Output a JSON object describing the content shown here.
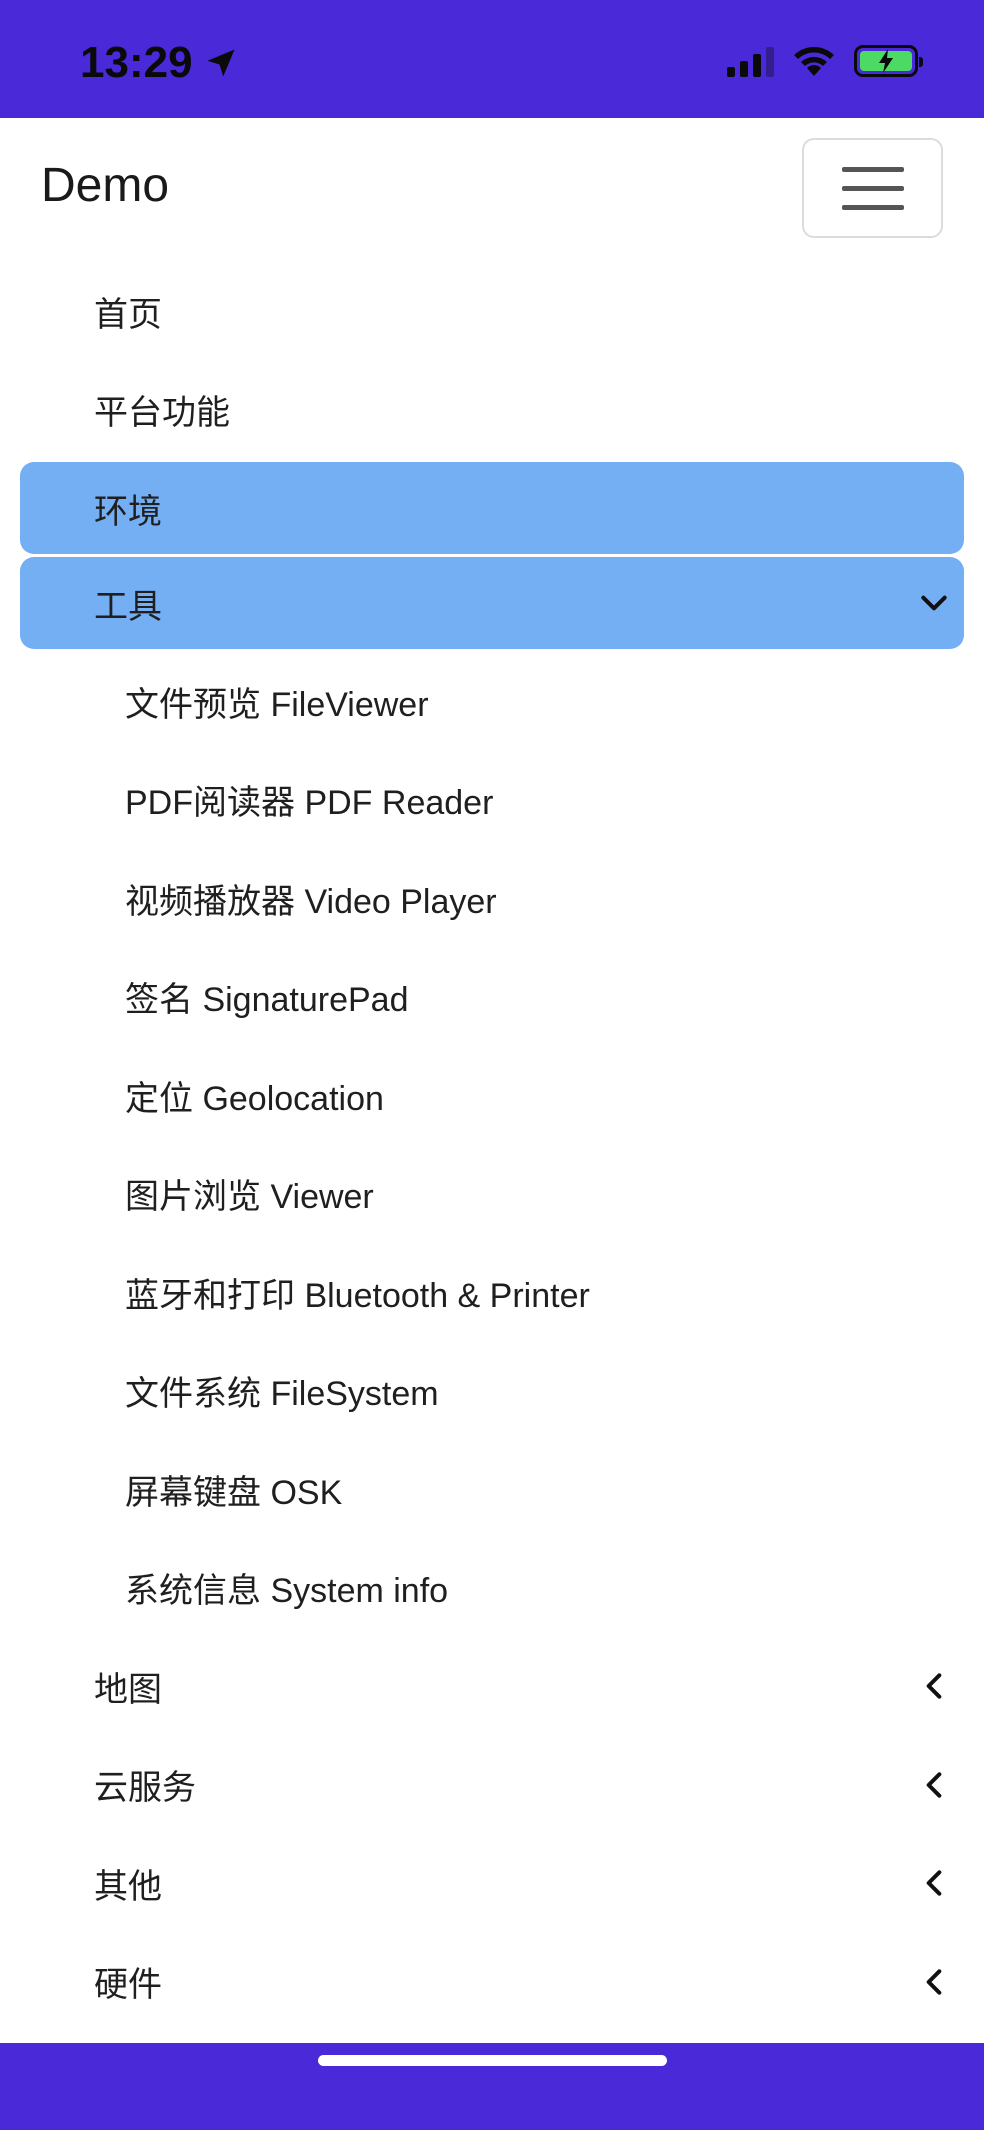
{
  "status_bar": {
    "time": "13:29",
    "background_color": "#4a2ad8",
    "icons": [
      "location-icon",
      "signal-icon",
      "wifi-icon",
      "battery-charging-icon"
    ]
  },
  "navbar": {
    "brand": "Demo",
    "toggler_icon": "hamburger-icon"
  },
  "menu": {
    "active_color": "#74aef3",
    "items": [
      {
        "label": "首页"
      },
      {
        "label": "平台功能"
      },
      {
        "label": "环境",
        "active": true
      },
      {
        "label": "工具",
        "active": true,
        "expanded": true
      },
      {
        "label": "文件预览 FileViewer"
      },
      {
        "label": "PDF阅读器 PDF Reader"
      },
      {
        "label": "视频播放器 Video Player"
      },
      {
        "label": "签名 SignaturePad"
      },
      {
        "label": "定位 Geolocation"
      },
      {
        "label": "图片浏览 Viewer"
      },
      {
        "label": "蓝牙和打印 Bluetooth & Printer"
      },
      {
        "label": "文件系统 FileSystem"
      },
      {
        "label": "屏幕键盘 OSK"
      },
      {
        "label": "系统信息 System info"
      },
      {
        "label": "地图"
      },
      {
        "label": "云服务"
      },
      {
        "label": "其他"
      },
      {
        "label": "硬件"
      }
    ]
  }
}
